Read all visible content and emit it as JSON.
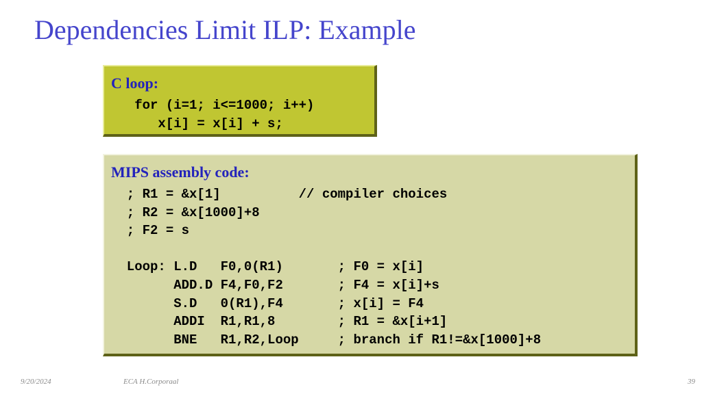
{
  "slide": {
    "title": "Dependencies Limit ILP: Example"
  },
  "block1": {
    "heading": "C loop:",
    "code": "   for (i=1; i<=1000; i++)\n      x[i] = x[i] + s;"
  },
  "block2": {
    "heading": "MIPS assembly code:",
    "code": "  ; R1 = &x[1]          // compiler choices\n  ; R2 = &x[1000]+8\n  ; F2 = s\n\n  Loop: L.D   F0,0(R1)       ; F0 = x[i]\n        ADD.D F4,F0,F2       ; F4 = x[i]+s\n        S.D   0(R1),F4       ; x[i] = F4\n        ADDI  R1,R1,8        ; R1 = &x[i+1]\n        BNE   R1,R2,Loop     ; branch if R1!=&x[1000]+8"
  },
  "footer": {
    "date": "9/20/2024",
    "author": "ECA  H.Corporaal",
    "page": "39"
  }
}
